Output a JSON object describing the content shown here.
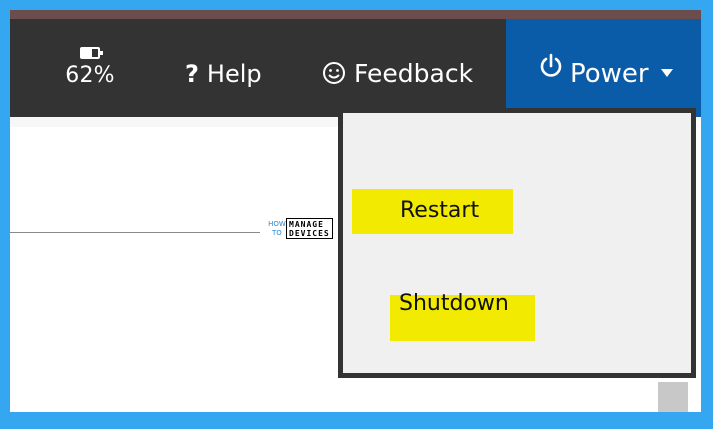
{
  "header": {
    "battery": {
      "percent_label": "62%",
      "icon": "battery-icon"
    },
    "help": {
      "symbol": "?",
      "label": "Help",
      "icon": "question-mark-icon"
    },
    "feedback": {
      "label": "Feedback",
      "icon": "smiley-icon"
    },
    "power": {
      "label": "Power",
      "icon": "power-icon",
      "caret_icon": "caret-down-icon"
    }
  },
  "power_menu": {
    "items": [
      {
        "label": "Restart",
        "highlighted": true
      },
      {
        "label": "Shutdown",
        "highlighted": true
      }
    ]
  },
  "watermark": {
    "line1": "HOW",
    "line2": "TO",
    "line3": "MANAGE",
    "line4": "DEVICES"
  },
  "colors": {
    "outer_border": "#35a6f0",
    "header_bg": "#333333",
    "power_bg": "#0b5ca8",
    "menu_bg": "#f0f0f0",
    "highlight": "#f2ea00"
  }
}
